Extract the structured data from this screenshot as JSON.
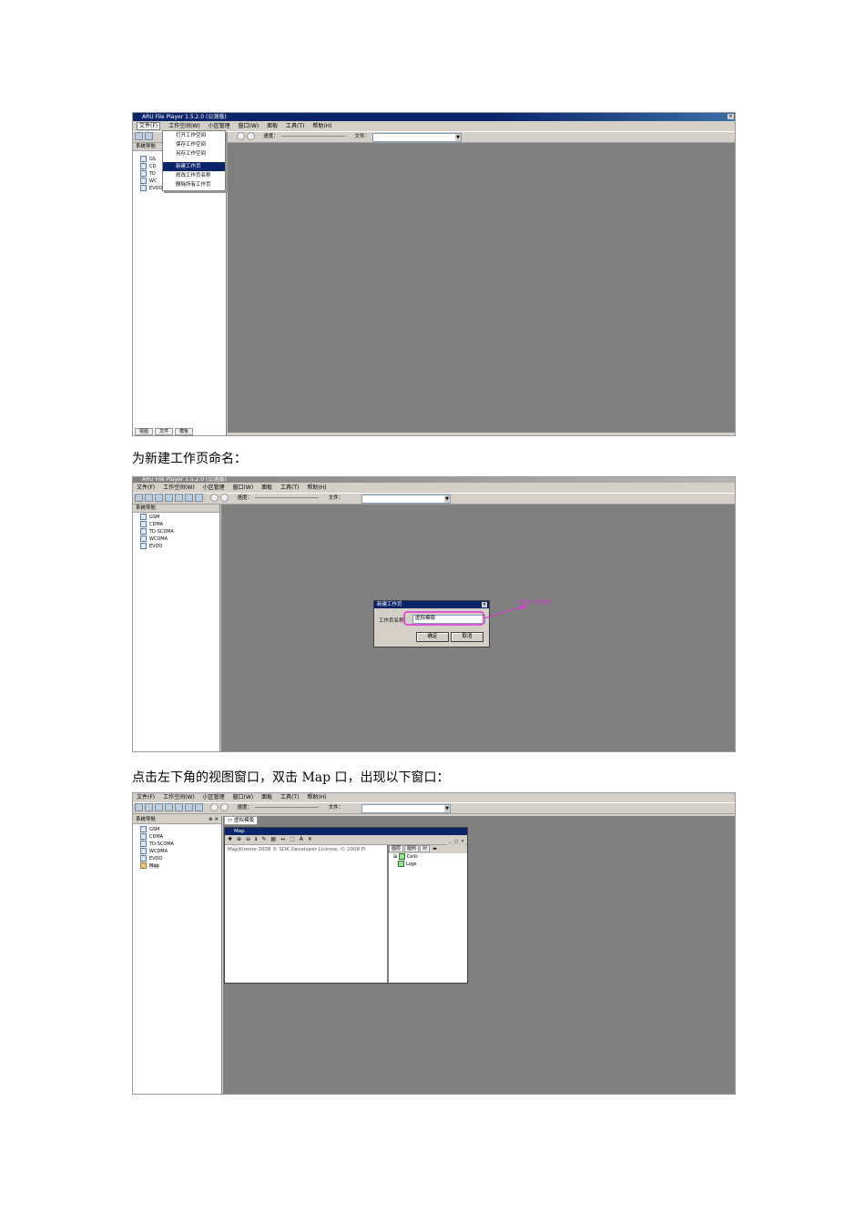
{
  "captions": {
    "c1": "为新建工作页命名：",
    "c2": "点击左下角的视图窗口，双击 Map 口，出现以下窗口："
  },
  "shot1": {
    "title": "ARU File Player 1.5.2.0 (公测版)",
    "menu": [
      "文件(F)",
      "工作空间(W)",
      "小区管理",
      "窗口(W)",
      "面板",
      "工具(T)",
      "帮助(H)"
    ],
    "speed_label": "速度：",
    "file_label": "文件：",
    "pane_title": "系统导航",
    "tree": [
      "GS",
      "CD",
      "TD",
      "WC",
      "EVDO"
    ],
    "dropdown": [
      "打开工作空间",
      "保存工作空间",
      "另存工作空间",
      "新建工作页",
      "修改工作页名称",
      "删除所有工作页"
    ],
    "selected_index": 3,
    "bottom_tabs": [
      "视图",
      "文件",
      "模板"
    ]
  },
  "shot2": {
    "title": "ARU File Player 1.5.2.0 (公测版)",
    "menu": [
      "文件(F)",
      "工作空间(W)",
      "小区管理",
      "窗口(W)",
      "面板",
      "工具(T)",
      "帮助(H)"
    ],
    "speed_label": "速度：",
    "file_label": "文件：",
    "pane_title": "系统导航",
    "tree": [
      "GSM",
      "CDMA",
      "TD-SCDMA",
      "WCDMA",
      "EVDO"
    ],
    "dialog": {
      "title": "新建工作页",
      "label": "工作页名称：",
      "value": "虚拟模版",
      "ok": "确定",
      "cancel": "取消"
    },
    "annotation": "新建工作页名称"
  },
  "shot3": {
    "menu": [
      "文件(F)",
      "工作空间(W)",
      "小区管理",
      "窗口(W)",
      "面板",
      "工具(T)",
      "帮助(H)"
    ],
    "speed_label": "速度：",
    "file_label": "文件：",
    "pane_title": "系统导航",
    "tree": [
      "GSM",
      "CDMA",
      "TD-SCDMA",
      "WCDMA",
      "EVDO",
      "Map"
    ],
    "work_tab": "虚拟模版",
    "map_title": "Map",
    "copyright": "MapXtreme 2008 © SDK Developer License, © 2008 Pi",
    "layer_tabs": [
      "图层",
      "图例",
      "对"
    ],
    "layers": [
      "Cells",
      "Logs"
    ]
  }
}
